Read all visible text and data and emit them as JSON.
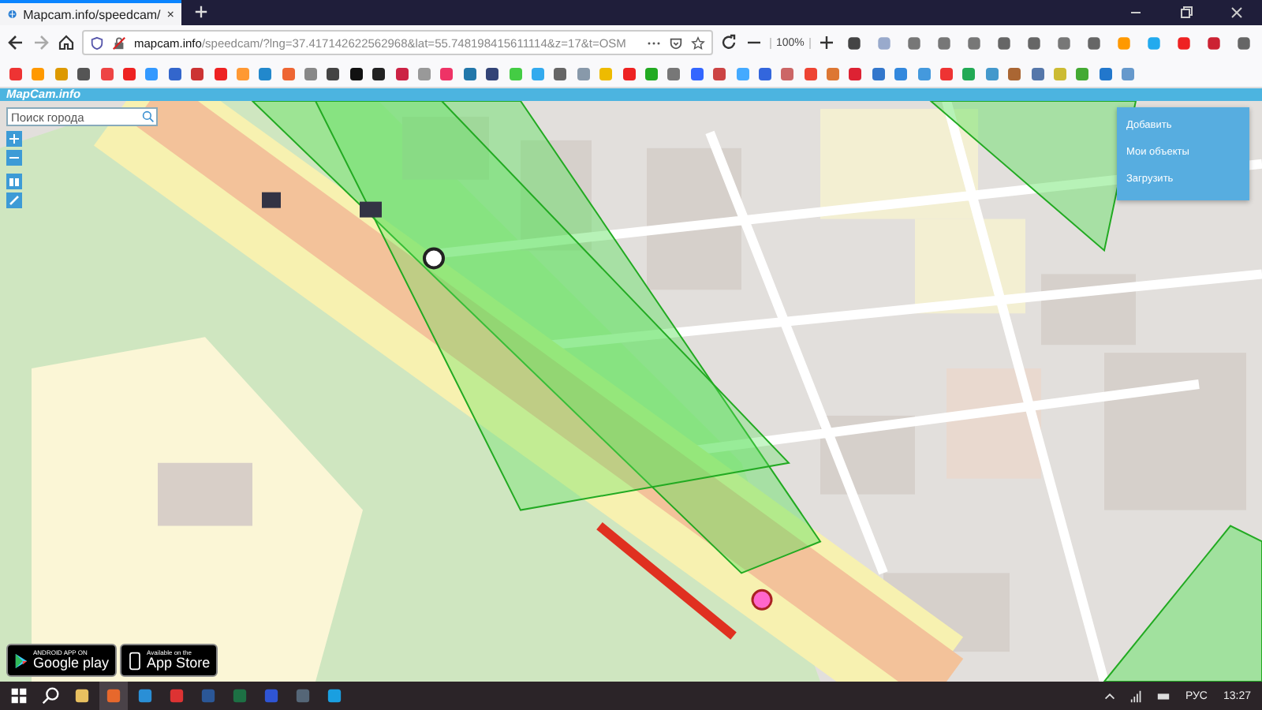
{
  "tab": {
    "title": "Mapcam.info/speedcam/"
  },
  "address_bar": {
    "domain": "mapcam.info",
    "path": "/speedcam/?lng=37.417142622562968&lat=55.748198415611114&z=17&t=OSM"
  },
  "zoom_level": "100%",
  "site": {
    "title": "MapCam.info"
  },
  "search": {
    "placeholder": "Поиск города"
  },
  "menu": [
    "Добавить",
    "Мои объекты",
    "Загрузить"
  ],
  "store_badges": [
    {
      "kind": "google",
      "small": "ANDROID APP ON",
      "large": "Google play"
    },
    {
      "kind": "apple",
      "small": "Available on the",
      "large": "App Store"
    }
  ],
  "taskbar": {
    "language": "РУС",
    "time": "13:27"
  }
}
